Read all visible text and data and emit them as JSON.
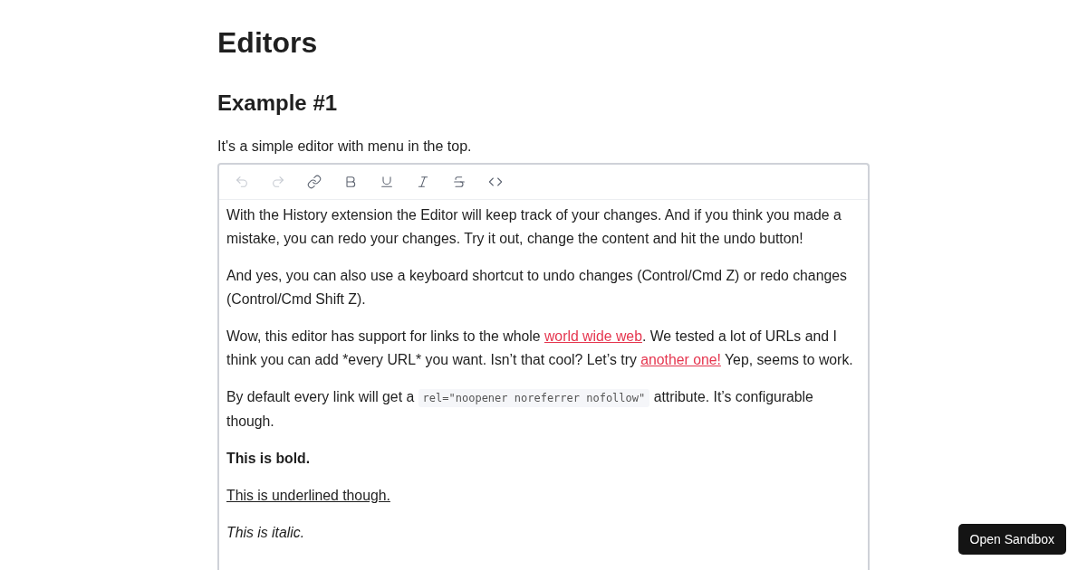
{
  "title": "Editors",
  "example": {
    "heading": "Example #1",
    "intro": "It's a simple editor with menu in the top.",
    "toolbar": [
      {
        "kind": "undo",
        "disabled": true
      },
      {
        "kind": "redo",
        "disabled": true
      },
      {
        "kind": "link",
        "disabled": false
      },
      {
        "kind": "bold",
        "disabled": false
      },
      {
        "kind": "underline",
        "disabled": false
      },
      {
        "kind": "italic",
        "disabled": false
      },
      {
        "kind": "strike",
        "disabled": false
      },
      {
        "kind": "code",
        "disabled": false
      }
    ],
    "paragraphs": [
      {
        "kind": "plain",
        "parts": [
          {
            "kind": "text",
            "text": "With the History extension the Editor will keep track of your changes. And if you think you made a mistake, you can redo your changes. Try it out, change the content and hit the undo button!"
          }
        ]
      },
      {
        "kind": "plain",
        "parts": [
          {
            "kind": "text",
            "text": "And yes, you can also use a keyboard shortcut to undo changes (Control/Cmd Z) or redo changes (Control/Cmd Shift Z)."
          }
        ]
      },
      {
        "kind": "plain",
        "parts": [
          {
            "kind": "text",
            "text": "Wow, this editor has support for links to the whole "
          },
          {
            "kind": "link",
            "text": "world wide web"
          },
          {
            "kind": "text",
            "text": ". We tested a lot of URLs and I think you can add *every URL* you want. Isn’t that cool? Let’s try "
          },
          {
            "kind": "link",
            "text": "another one!"
          },
          {
            "kind": "text",
            "text": " Yep, seems to work."
          }
        ]
      },
      {
        "kind": "plain",
        "parts": [
          {
            "kind": "text",
            "text": "By default every link will get a "
          },
          {
            "kind": "code",
            "text": "rel=\"noopener noreferrer nofollow\""
          },
          {
            "kind": "text",
            "text": " attribute. It’s configurable though."
          }
        ]
      },
      {
        "kind": "bold",
        "parts": [
          {
            "kind": "text",
            "text": "This is bold."
          }
        ]
      },
      {
        "kind": "underline",
        "parts": [
          {
            "kind": "text",
            "text": "This is underlined though."
          }
        ]
      },
      {
        "kind": "italic",
        "parts": [
          {
            "kind": "text",
            "text": "This is italic."
          }
        ]
      }
    ]
  },
  "sandbox_button": "Open Sandbox"
}
